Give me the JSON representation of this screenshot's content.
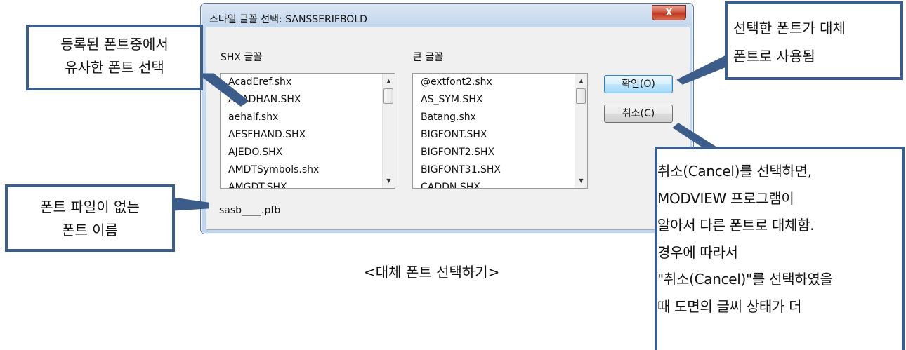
{
  "dialog": {
    "title": "스타일 글꼴 선택: SANSSERIFBOLD",
    "close_glyph": "X",
    "shx_label": "SHX 글꼴",
    "big_label": "큰 글꼴",
    "shx_fonts": [
      "AcadEref.shx",
      "ACADHAN.SHX",
      "aehalf.shx",
      "AESFHAND.SHX",
      "AJEDO.SHX",
      "AMDTSymbols.shx",
      "AMGDT.SHX"
    ],
    "big_fonts": [
      "@extfont2.shx",
      "AS_SYM.SHX",
      "Batang.shx",
      "BIGFONT.SHX",
      "BIGFONT2.SHX",
      "BIGFONT31.SHX",
      "CADDN.SHX"
    ],
    "ok_label": "확인(O)",
    "cancel_label": "취소(C)",
    "missing_font_file": "sasb____.pfb"
  },
  "callouts": {
    "similar_font": [
      "등록된 폰트중에서",
      "유사한 폰트 선택"
    ],
    "replacement_used": [
      "선택한 폰트가 대체",
      "폰트로 사용됨"
    ],
    "missing_name": [
      "폰트 파일이 없는",
      "폰트 이름"
    ],
    "cancel_note": [
      "취소(Cancel)를 선택하면,",
      "MODVIEW 프로그램이",
      "알아서 다른 폰트로 대체함.",
      "경우에 따라서",
      "\"취소(Cancel)\"를 선택하였을",
      "때 도면의 글씨 상태가 더"
    ]
  },
  "caption": "<대체 폰트 선택하기>",
  "colors": {
    "callout_border": "#3c5d8a",
    "close_button": "#c0381f",
    "default_button_border": "#3c7fb1"
  }
}
